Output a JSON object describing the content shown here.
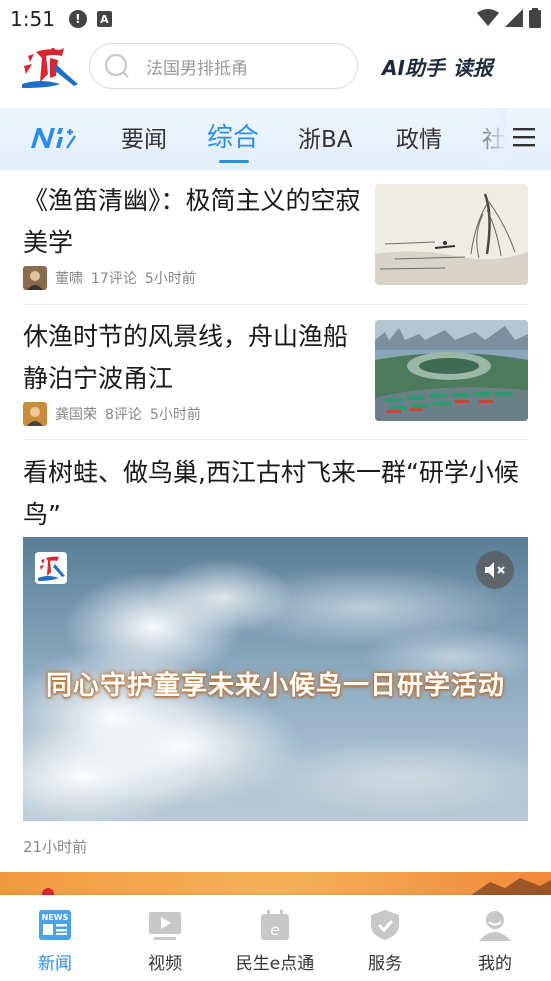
{
  "status_bar": {
    "time": "1:51",
    "alert_glyph": "!",
    "a_glyph": "A"
  },
  "header": {
    "search_placeholder": "法国男排抵甬",
    "ai_label": "AI助手",
    "read_label": "读报"
  },
  "tabs": [
    {
      "label": "要闻",
      "active": false
    },
    {
      "label": "综合",
      "active": true
    },
    {
      "label": "浙BA",
      "active": false
    },
    {
      "label": "政情",
      "active": false
    },
    {
      "label": "社",
      "active": false
    }
  ],
  "articles": [
    {
      "title": "《渔笛清幽》：极简主义的空寂美学",
      "author": "董啸",
      "comments": "17评论",
      "time": "5小时前"
    },
    {
      "title": "休渔时节的风景线，舟山渔船静泊宁波甬江",
      "author": "龚国荣",
      "comments": "8评论",
      "time": "5小时前"
    },
    {
      "title": "看树蛙、做鸟巢,西江古村飞来一群“研学小候鸟”",
      "video_caption": "同心守护童享未来小候鸟一日研学活动",
      "time": "21小时前"
    }
  ],
  "bottom_nav": [
    {
      "label": "新闻",
      "icon": "news-icon",
      "active": true
    },
    {
      "label": "视频",
      "icon": "video-play-icon",
      "active": false
    },
    {
      "label": "民生e点通",
      "icon": "calendar-e-icon",
      "active": false
    },
    {
      "label": "服务",
      "icon": "shield-check-icon",
      "active": false
    },
    {
      "label": "我的",
      "icon": "user-icon",
      "active": false
    }
  ],
  "colors": {
    "accent": "#2a8ee8",
    "logo_red": "#d7262e",
    "logo_blue": "#1f6fc4"
  }
}
